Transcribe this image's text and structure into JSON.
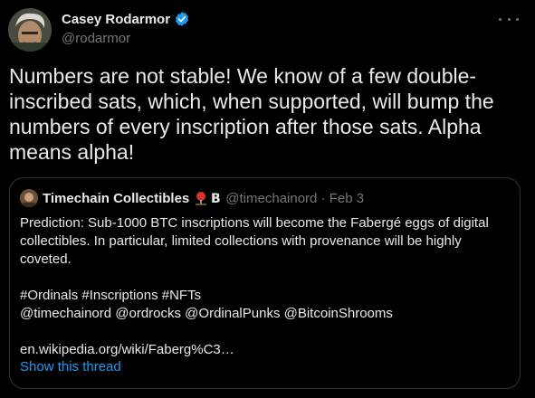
{
  "author": {
    "name": "Casey Rodarmor",
    "handle": "@rodarmor"
  },
  "tweet": {
    "text": "Numbers are not stable! We know of a few double-inscribed sats, which, when supported, will bump the numbers of every inscription after those sats. Alpha means alpha!"
  },
  "quote": {
    "author_name": "Timechain Collectibles",
    "emoji_letter": "B",
    "meta": "@timechainord · Feb 3",
    "text_line1": "Prediction:  Sub-1000 BTC inscriptions will become the Fabergé eggs of digital collectibles.  In particular, limited collections with provenance will be highly coveted.",
    "hashtags": "#Ordinals #Inscriptions #NFTs",
    "mentions": "@timechainord @ordrocks  @OrdinalPunks @BitcoinShrooms",
    "link": "en.wikipedia.org/wiki/Faberg%C3…",
    "show_thread": "Show this thread"
  },
  "colors": {
    "background": "#000000",
    "text": "#e7e9ea",
    "secondary": "#71767b",
    "accent": "#1d9bf0",
    "border": "#2f3336"
  },
  "icons": {
    "verified": "verified-badge-icon",
    "more": "more-options-icon"
  }
}
